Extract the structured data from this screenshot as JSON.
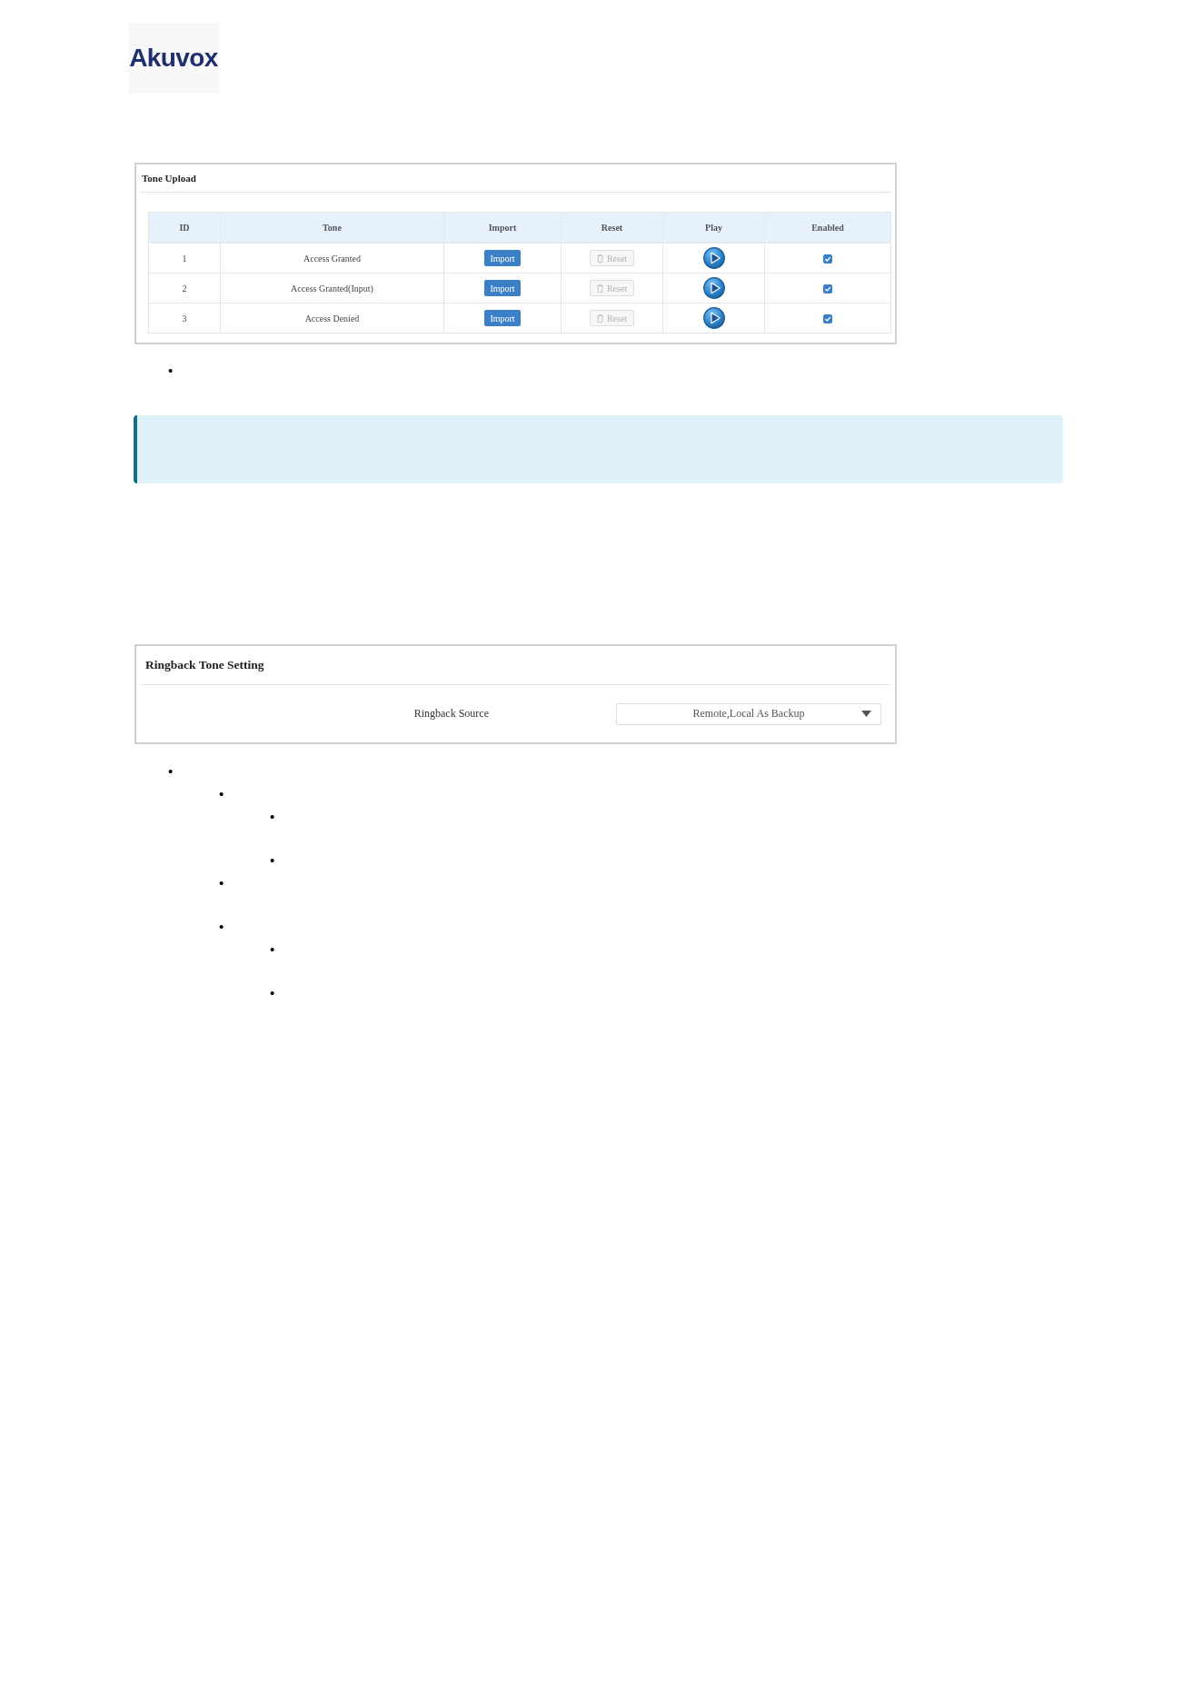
{
  "logo": {
    "text": "Akuvox"
  },
  "tone_upload": {
    "title": "Tone Upload",
    "columns": [
      "ID",
      "Tone",
      "Import",
      "Reset",
      "Play",
      "Enabled"
    ],
    "rows": [
      {
        "id": "1",
        "tone": "Access Granted",
        "import": "Import",
        "reset": "Reset",
        "reset_disabled": true,
        "enabled": true
      },
      {
        "id": "2",
        "tone": "Access Granted(Input)",
        "import": "Import",
        "reset": "Reset",
        "reset_disabled": true,
        "enabled": true
      },
      {
        "id": "3",
        "tone": "Access Denied",
        "import": "Import",
        "reset": "Reset",
        "reset_disabled": true,
        "enabled": true
      }
    ]
  },
  "bullets_after_tone_upload": [
    {
      "marker": "•"
    }
  ],
  "callout": {
    "kind": "info"
  },
  "ringback_tone_setting": {
    "title": "Ringback Tone Setting",
    "fields": [
      {
        "label": "Ringback Source",
        "value": "Remote,Local As Backup"
      }
    ]
  },
  "bullets_after_ringback": [
    {
      "marker": "•",
      "children": [
        {
          "marker": "•",
          "children": [
            {
              "marker": "•"
            },
            {
              "marker": "•"
            }
          ]
        },
        {
          "marker": "•"
        },
        {
          "marker": "•",
          "children": [
            {
              "marker": "•"
            },
            {
              "marker": "•"
            }
          ]
        }
      ]
    }
  ]
}
